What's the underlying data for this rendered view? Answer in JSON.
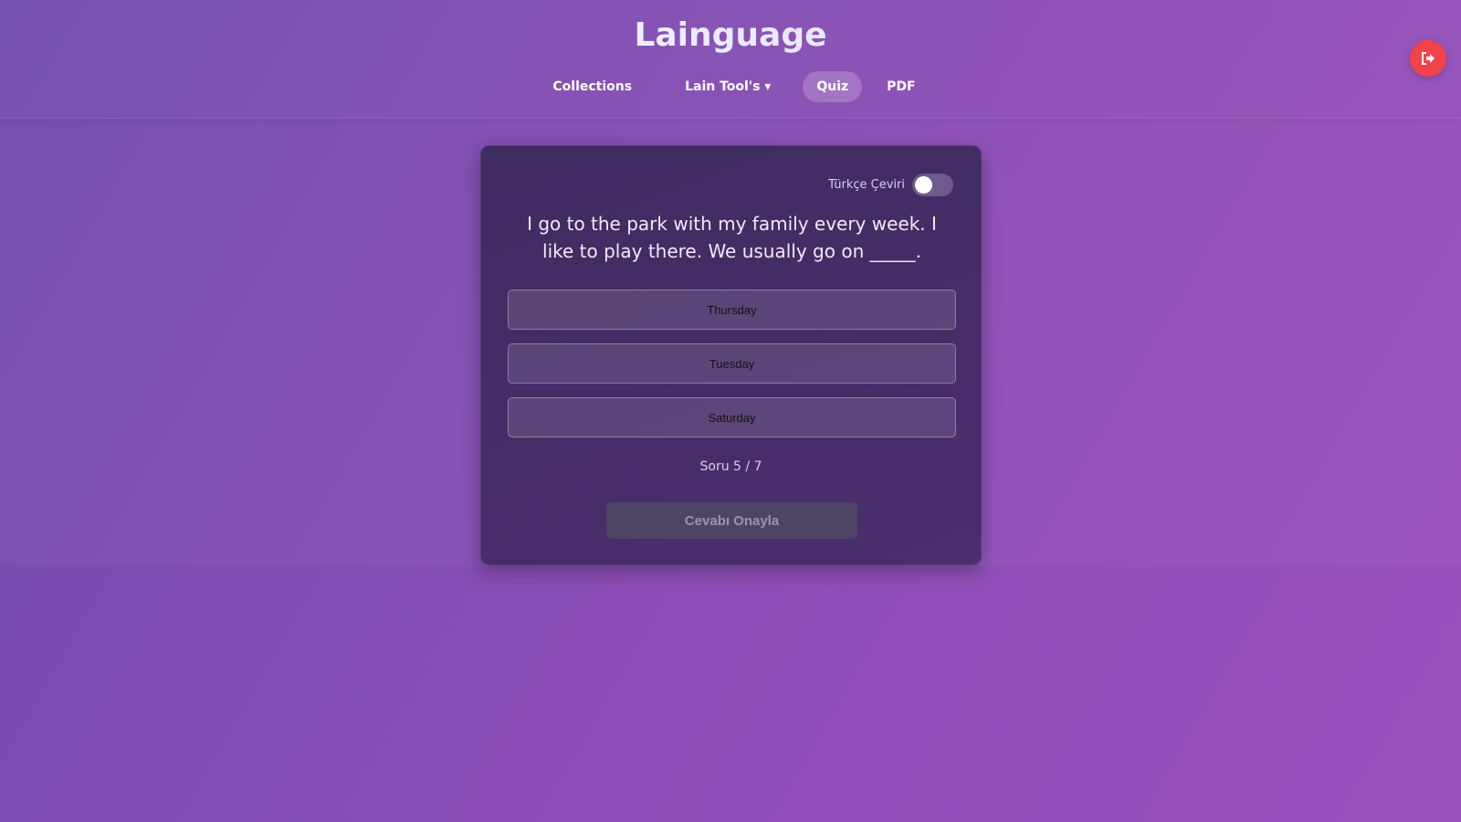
{
  "header": {
    "title": "Lainguage",
    "nav": [
      {
        "label": "Collections"
      },
      {
        "label": "Lain Tool's ▾"
      },
      {
        "label": "Quiz",
        "active": true
      },
      {
        "label": "PDF"
      }
    ],
    "logout_icon": "logout-icon"
  },
  "quiz": {
    "translate_label": "Türkçe Çeviri",
    "translate_on": false,
    "question": "I go to the park with my family every week. I like to play there. We usually go on _____.",
    "options": [
      "Thursday",
      "Tuesday",
      "Saturday"
    ],
    "counter": "Soru 5 / 7",
    "confirm_label": "Cevabı Onayla"
  },
  "colors": {
    "logout": "#f2434a",
    "card": "#45306a"
  }
}
